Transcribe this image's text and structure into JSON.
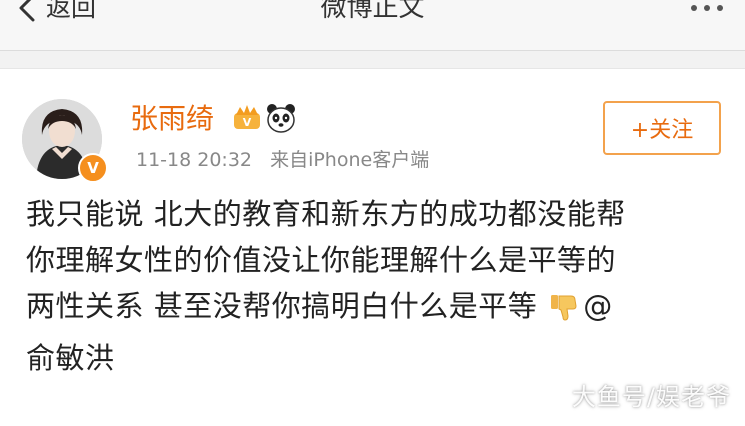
{
  "nav": {
    "back_label": "返回",
    "title": "微博正文"
  },
  "post": {
    "author": "张雨绮",
    "timestamp": "11-18 20:32",
    "source": "来自iPhone客户端",
    "follow_label": "+关注",
    "verify_mark": "V",
    "text_lines": [
      "我只能说 北大的教育和新东方的成功都没能帮",
      "你理解女性的价值没让你能理解什么是平等的",
      "两性关系 甚至没帮你搞明白什么是平等"
    ],
    "mention_prefix": "@",
    "mention_name": "俞敏洪"
  },
  "watermark": "大鱼号/娱老爷",
  "colors": {
    "accent": "#e86b0f",
    "follow_border": "#f3a24c",
    "verify": "#f58f1e"
  },
  "icons": {
    "back": "back-chevron-icon",
    "more": "more-dots-icon",
    "vip": "vip-crown-icon",
    "panda": "panda-icon",
    "emoji": "thumbs-down-emoji-icon"
  }
}
